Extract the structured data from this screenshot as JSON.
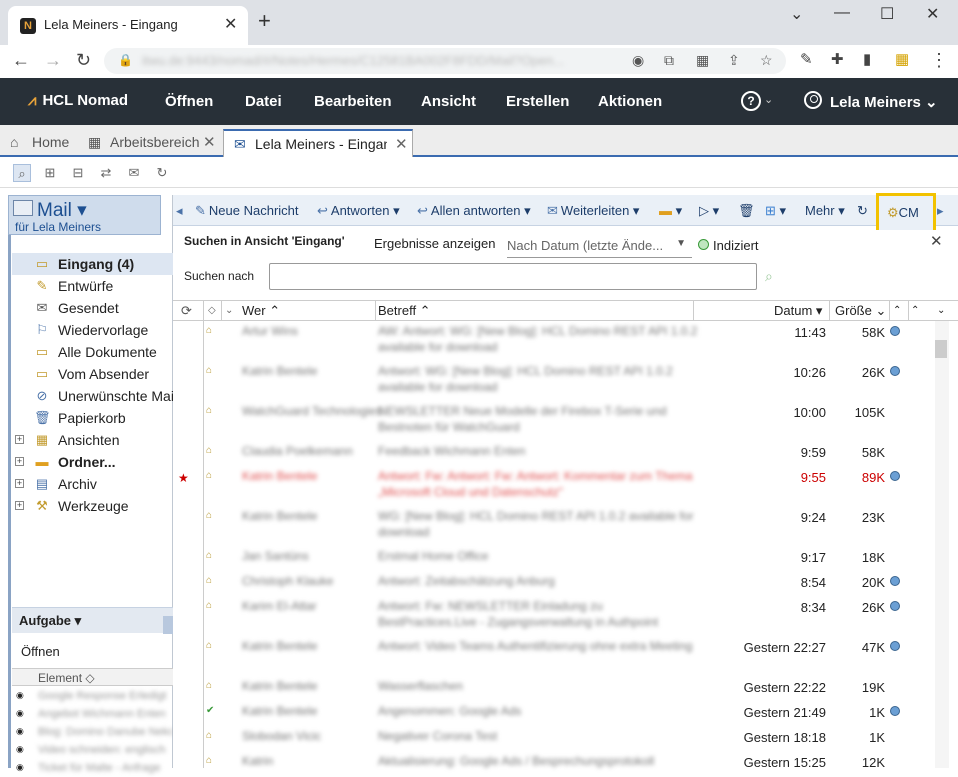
{
  "browser": {
    "tab_title": "Lela Meiners - Eingang",
    "favicon_glyph": "N",
    "url": "itwu.de:9443/nomad/#/Notes/Hermes/C12581BA002F8FDD/Mail?Open..."
  },
  "app": {
    "logo": "HCL Nomad",
    "menus": [
      "Öffnen",
      "Datei",
      "Bearbeiten",
      "Ansicht",
      "Erstellen",
      "Aktionen"
    ],
    "help_glyph": "?",
    "user": "Lela Meiners"
  },
  "tabs": [
    "Home",
    "Arbeitsbereich",
    "Lela Meiners - Eingang"
  ],
  "mail_header": {
    "title": "Mail",
    "subtitle": "für Lela Meiners"
  },
  "nav_items": [
    {
      "label": "Eingang (4)",
      "icon": "inbox-icon"
    },
    {
      "label": "Entwürfe",
      "icon": "drafts-icon"
    },
    {
      "label": "Gesendet",
      "icon": "sent-icon"
    },
    {
      "label": "Wiedervorlage",
      "icon": "followup-icon"
    },
    {
      "label": "Alle Dokumente",
      "icon": "all-documents-icon"
    },
    {
      "label": "Vom Absender",
      "icon": "by-sender-icon"
    },
    {
      "label": "Unerwünschte Mail",
      "icon": "junk-mail-icon"
    },
    {
      "label": "Papierkorb",
      "icon": "trash-icon"
    },
    {
      "label": "Ansichten",
      "icon": "views-icon"
    },
    {
      "label": "Ordner...",
      "icon": "folder-icon"
    },
    {
      "label": "Archiv",
      "icon": "archive-icon"
    },
    {
      "label": "Werkzeuge",
      "icon": "tools-icon"
    }
  ],
  "task_panel": {
    "title": "Aufgabe",
    "open_label": "Öffnen",
    "element_header": "Element",
    "rows": [
      "Google Response Erledigt",
      "Angebot Wichmann Enten",
      "Blog: Domino Danube Neko",
      "Video schneiden: englisch",
      "Ticket für Malte - Anfrage"
    ]
  },
  "toolbar": {
    "new_message": "Neue Nachricht",
    "reply": "Antworten",
    "reply_all": "Allen antworten",
    "forward": "Weiterleiten",
    "more": "Mehr",
    "cm": "CM"
  },
  "search": {
    "title": "Suchen in Ansicht 'Eingang'",
    "show_results": "Ergebnisse anzeigen",
    "sort_value": "Nach Datum (letzte Ände...",
    "indexed": "Indiziert",
    "search_label": "Suchen nach",
    "search_value": ""
  },
  "columns": {
    "who": "Wer",
    "subject": "Betreff",
    "date": "Datum",
    "size": "Größe"
  },
  "rows": [
    {
      "from": "Artur Wins",
      "subject": "AW: Antwort: WG: [New Blog]: HCL Domino REST API 1.0.2 available for download",
      "date": "11:43",
      "size": "58K",
      "attach": true
    },
    {
      "from": "Katrin Bentele",
      "subject": "Antwort: WG: [New Blog]: HCL Domino REST API 1.0.2 available for download",
      "date": "10:26",
      "size": "26K",
      "attach": true
    },
    {
      "from": "WatchGuard Technologies",
      "subject": "NEWSLETTER Neue Modelle der Firebox T-Serie und Bestnoten für WatchGuard",
      "date": "10:00",
      "size": "105K",
      "attach": false
    },
    {
      "from": "Claudia Poelkemann",
      "subject": "Feedback Wichmann Enten",
      "date": "9:59",
      "size": "58K",
      "attach": false
    },
    {
      "from": "Katrin Bentele",
      "subject": "Antwort: Fw: Antwort: Fw: Antwort: Kommentar zum Thema „Microsoft Cloud und Datenschutz\"",
      "date": "9:55",
      "size": "89K",
      "attach": true,
      "red": true
    },
    {
      "from": "Katrin Bentele",
      "subject": "WG: [New Blog]: HCL Domino REST API 1.0.2 available for download",
      "date": "9:24",
      "size": "23K",
      "attach": false
    },
    {
      "from": "Jan Santüns",
      "subject": "Erstmal Home Office",
      "date": "9:17",
      "size": "18K",
      "attach": false
    },
    {
      "from": "Christoph Klauke",
      "subject": "Antwort: Zeitabschätzung Anburg",
      "date": "8:54",
      "size": "20K",
      "attach": true
    },
    {
      "from": "Karim El-Attar",
      "subject": "Antwort: Fw: NEWSLETTER Einladung zu BestPractices.Live - Zugangsverwaltung in Authpoint",
      "date": "8:34",
      "size": "26K",
      "attach": true
    },
    {
      "from": "Katrin Bentele",
      "subject": "Antwort: Video Teams Authentifizierung ohne extra Meeting",
      "date": "Gestern 22:27",
      "size": "47K",
      "attach": true
    },
    {
      "from": "Katrin Bentele",
      "subject": "Wasserflaschen",
      "date": "Gestern 22:22",
      "size": "19K",
      "attach": false
    },
    {
      "from": "Katrin Bentele",
      "subject": "Angenommen: Google Ads",
      "date": "Gestern 21:49",
      "size": "1K",
      "attach": true
    },
    {
      "from": "Slobodan Vicic",
      "subject": "Negativer Corona Test",
      "date": "Gestern 18:18",
      "size": "1K",
      "attach": false
    },
    {
      "from": "Katrin",
      "subject": "Aktualisierung: Google Ads / Besprechungsprotokoll",
      "date": "Gestern 15:25",
      "size": "12K",
      "attach": false
    }
  ]
}
